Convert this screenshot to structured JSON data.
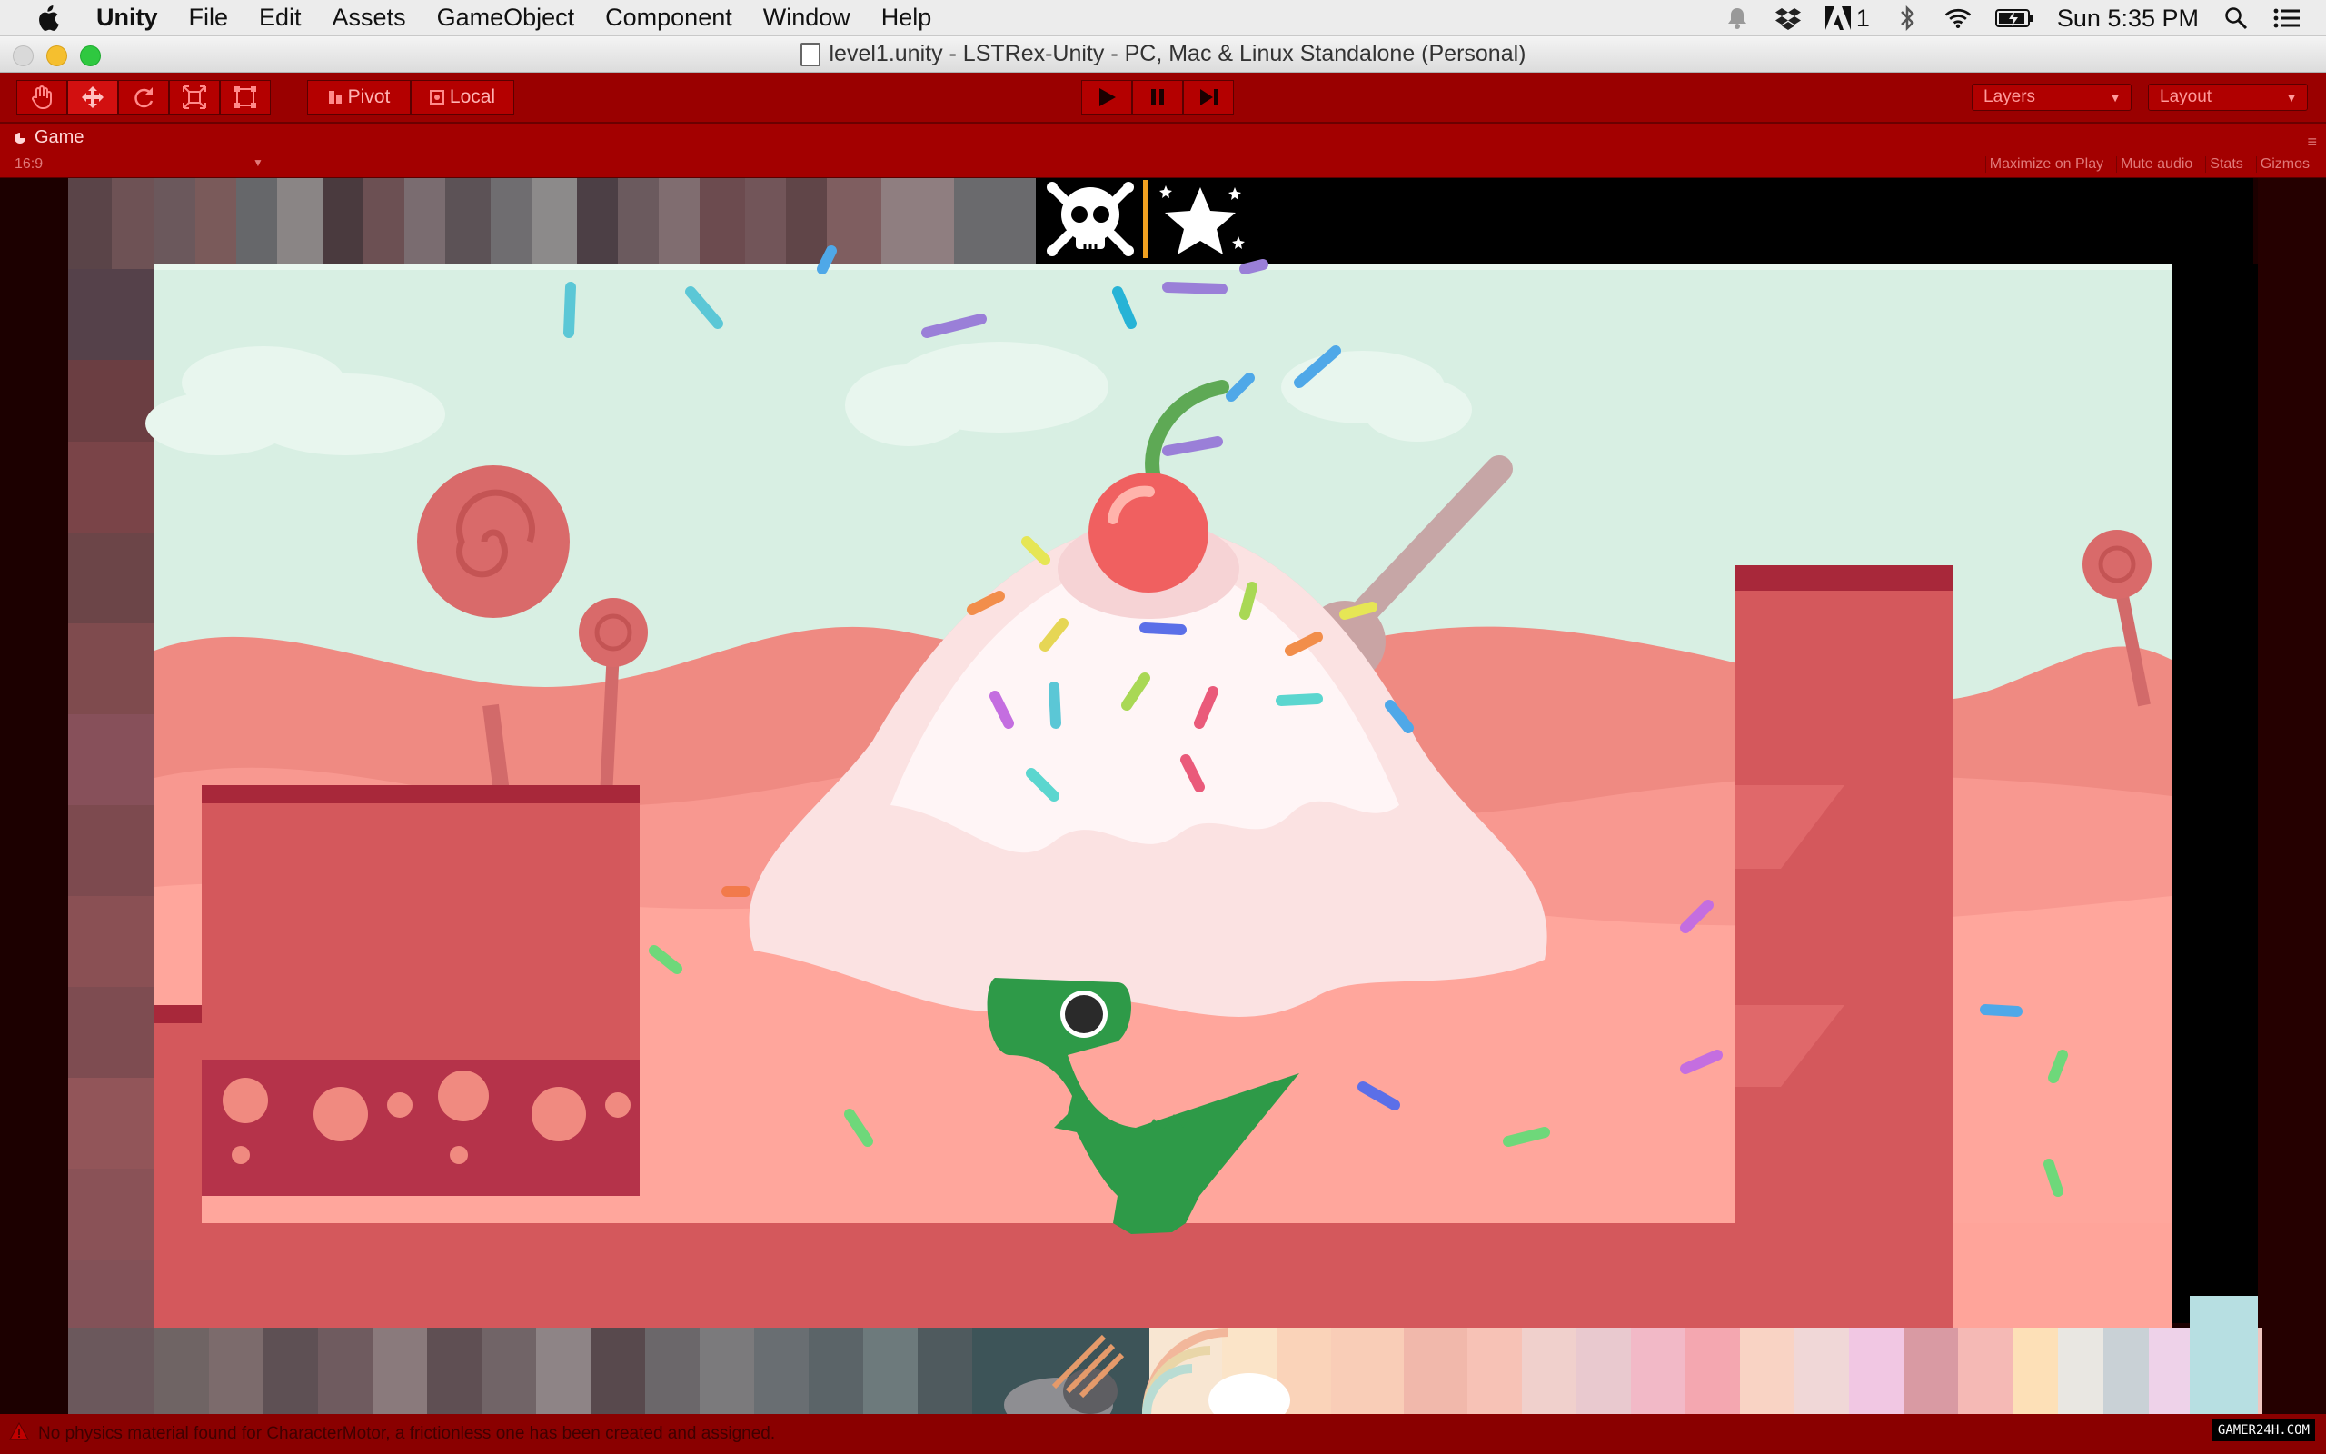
{
  "menubar": {
    "app": "Unity",
    "items": [
      "File",
      "Edit",
      "Assets",
      "GameObject",
      "Component",
      "Window",
      "Help"
    ],
    "adobe_count": "1",
    "clock": "Sun 5:35 PM",
    "icons": [
      "notification-icon",
      "dropbox-icon",
      "adobe-icon",
      "bluetooth-icon",
      "wifi-icon",
      "battery-icon",
      "spotlight-icon",
      "notification-center-icon"
    ]
  },
  "window": {
    "title": "level1.unity - LSTRex-Unity - PC, Mac & Linux Standalone (Personal)"
  },
  "toolbar": {
    "tools": [
      "hand-tool",
      "move-tool",
      "rotate-tool",
      "scale-tool",
      "rect-tool"
    ],
    "pivot_label": "Pivot",
    "local_label": "Local",
    "layers_label": "Layers",
    "layout_label": "Layout"
  },
  "game_panel": {
    "tab_label": "Game",
    "aspect": "16:9",
    "options": [
      "Maximize on Play",
      "Mute audio",
      "Stats",
      "Gizmos"
    ]
  },
  "hud": {
    "icons": [
      "skull-icon",
      "star-icon"
    ]
  },
  "status": {
    "message": "No physics material found for CharacterMotor, a frictionless one has been created and assigned."
  },
  "watermark": "GAMER24H.COM",
  "colors": {
    "playmode_tint": "#9a0000",
    "sky": "#d9efe4",
    "candy_ground": "#d4585c",
    "dino": "#2e9a48"
  }
}
